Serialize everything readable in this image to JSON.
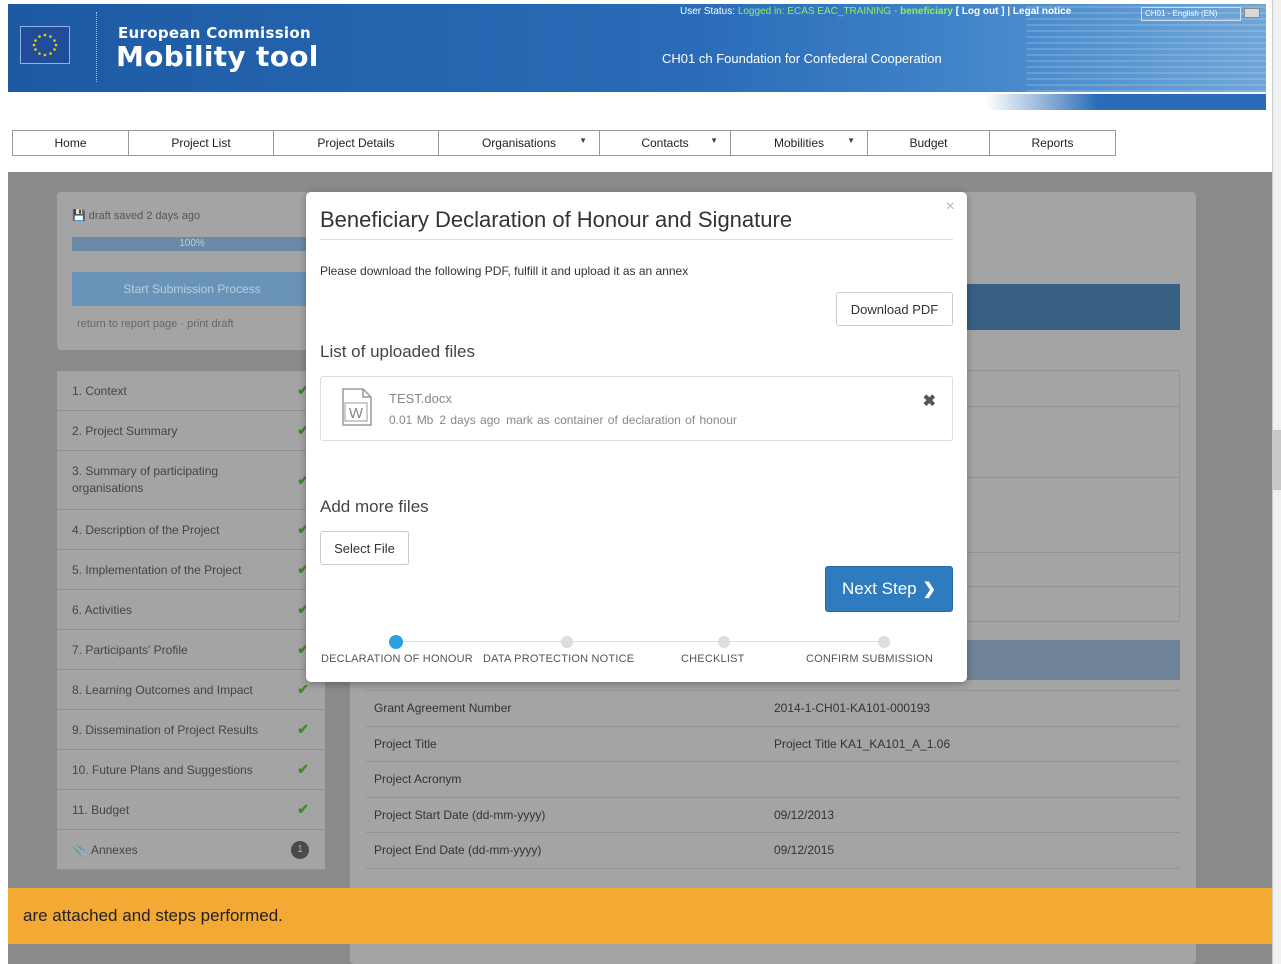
{
  "header": {
    "agency": "European Commission",
    "app_title": "Mobility tool",
    "organisation": "CH01 ch Foundation for Confederal Cooperation",
    "status_label": "User Status:",
    "status_value": "Logged in: ECAS EAC_TRAINING - ",
    "status_role": "beneficiary",
    "logout": "[ Log out ]",
    "legal": "| Legal notice",
    "language": "CH01 - English (EN)"
  },
  "nav": {
    "items": [
      {
        "label": "Home"
      },
      {
        "label": "Project List"
      },
      {
        "label": "Project Details"
      },
      {
        "label": "Organisations"
      },
      {
        "label": "Contacts"
      },
      {
        "label": "Mobilities"
      },
      {
        "label": "Budget"
      },
      {
        "label": "Reports"
      }
    ]
  },
  "sidebar": {
    "draft_status": "draft saved 2 days ago",
    "progress_label": "100%",
    "progress": 1.0,
    "start_button": "Start Submission Process",
    "return_link": "return to report page",
    "separator": "·",
    "print_link": "print draft",
    "steps": [
      {
        "label": "1. Context"
      },
      {
        "label": "2. Project Summary"
      },
      {
        "label": "3. Summary of participating organisations"
      },
      {
        "label": "4. Description of the Project"
      },
      {
        "label": "5. Implementation of the Project"
      },
      {
        "label": "6. Activities"
      },
      {
        "label": "7. Participants' Profile"
      },
      {
        "label": "8. Learning Outcomes and Impact"
      },
      {
        "label": "9. Dissemination of Project Results"
      },
      {
        "label": "10. Future Plans and Suggestions"
      },
      {
        "label": "11. Budget"
      }
    ],
    "annexes_label": "Annexes",
    "annexes_count": "1"
  },
  "project_info": [
    {
      "key": "Grant Agreement Number",
      "value": "2014-1-CH01-KA101-000193"
    },
    {
      "key": "Project Title",
      "value": "Project Title KA1_KA101_A_1.06"
    },
    {
      "key": "Project Acronym",
      "value": ""
    },
    {
      "key": "Project Start Date (dd-mm-yyyy)",
      "value": "09/12/2013"
    },
    {
      "key": "Project End Date (dd-mm-yyyy)",
      "value": "09/12/2015"
    }
  ],
  "modal": {
    "title": "Beneficiary Declaration of Honour and Signature",
    "close_glyph": "×",
    "description": "Please download the following PDF, fulfill it and upload it as an annex",
    "download_button": "Download PDF",
    "uploaded_heading": "List of uploaded files",
    "file": {
      "name": "TEST.docx",
      "size": "0.01 Mb",
      "date": "2 days ago",
      "action": "mark as container of declaration of honour",
      "remove_glyph": "✖"
    },
    "add_heading": "Add more files",
    "select_button": "Select File",
    "next_button": "Next Step",
    "next_glyph": "❯",
    "wizard": [
      {
        "label": "DECLARATION OF HONOUR",
        "active": true
      },
      {
        "label": "DATA PROTECTION NOTICE",
        "active": false
      },
      {
        "label": "CHECKLIST",
        "active": false
      },
      {
        "label": "CONFIRM SUBMISSION",
        "active": false
      }
    ]
  },
  "banner": {
    "text": "are attached and steps performed."
  },
  "colors": {
    "header_blue": "#1d5aa3",
    "banner_orange": "#f4a935",
    "primary_button": "#2f7bc0",
    "wizard_active": "#2aa0e0",
    "check_green": "#3d8a27"
  }
}
